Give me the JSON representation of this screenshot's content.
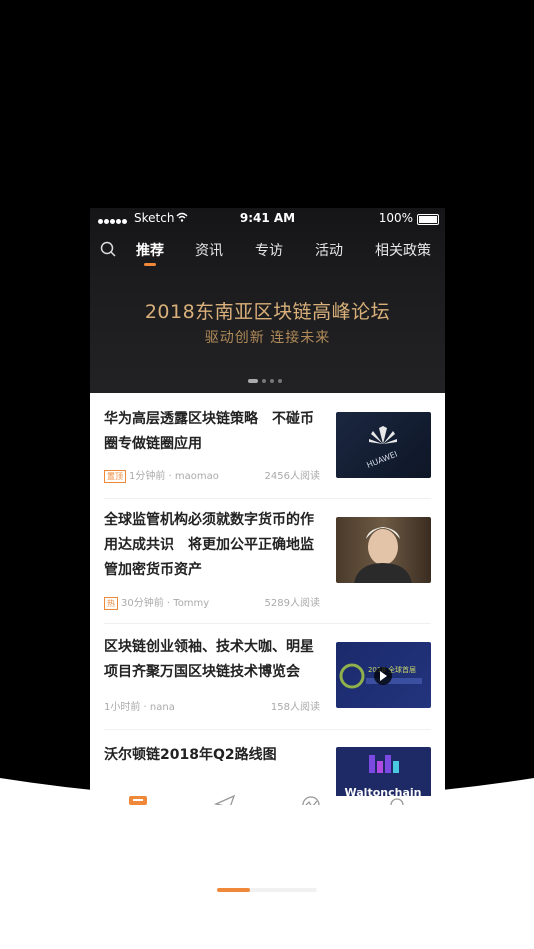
{
  "status_bar": {
    "carrier": "Sketch",
    "time": "9:41 AM",
    "battery": "100%"
  },
  "nav": {
    "tabs": [
      {
        "label": "推荐",
        "active": true
      },
      {
        "label": "资讯",
        "active": false
      },
      {
        "label": "专访",
        "active": false
      },
      {
        "label": "活动",
        "active": false
      },
      {
        "label": "相关政策",
        "active": false
      }
    ],
    "search_icon": "search-icon"
  },
  "banner": {
    "title": "2018东南亚区块链高峰论坛",
    "subtitle": "驱动创新  连接未来",
    "slides": 4,
    "active_slide": 1
  },
  "articles": [
    {
      "title": "华为高层透露区块链策略　不碰币圈专做链圈应用",
      "badge": "置顶",
      "time": "1分钟前",
      "author": "maomao",
      "reads": "2456人阅读",
      "thumb_text": "HUAWEI"
    },
    {
      "title": "全球监管机构必须就数字货币的作用达成共识　将更加公平正确地监管加密货币资产",
      "badge": "热",
      "time": "30分钟前",
      "author": "Tommy",
      "reads": "5289人阅读",
      "thumb_text": ""
    },
    {
      "title": "区块链创业领袖、技术大咖、明星项目齐聚万国区块链技术博览会",
      "badge": "",
      "time": "1小时前",
      "author": "nana",
      "reads": "158人阅读",
      "thumb_text": "2018 全球首届"
    },
    {
      "title": "沃尔顿链2018年Q2路线图",
      "badge": "",
      "time": "",
      "author": "",
      "reads": "",
      "thumb_text": "Waltonchain"
    }
  ],
  "tabbar": {
    "icons": [
      "news-icon",
      "send-icon",
      "market-icon",
      "profile-icon"
    ],
    "active": 0
  },
  "colors": {
    "accent": "#f0883a",
    "gold": "#d9b07a",
    "dark": "#1c1c1e"
  }
}
